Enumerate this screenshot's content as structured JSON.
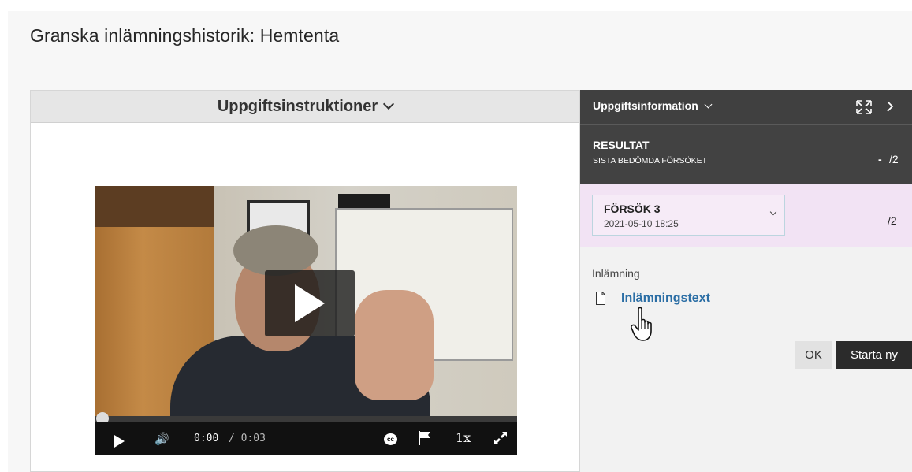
{
  "page": {
    "title": "Granska inlämningshistorik: Hemtenta"
  },
  "left_panel": {
    "header_label": "Uppgiftsinstruktioner"
  },
  "video": {
    "current_time": "0:00",
    "duration": "/ 0:03",
    "speed_label": "1x",
    "cc_label": "cc",
    "progress": 0
  },
  "right_panel": {
    "header_title": "Uppgiftsinformation",
    "result": {
      "title": "RESULTAT",
      "subtitle": "SISTA BEDÖMDA FÖRSÖKET",
      "score": "-",
      "max": "/2"
    },
    "attempt": {
      "title": "FÖRSÖK 3",
      "date": "2021-05-10 18:25",
      "max": "/2"
    },
    "submission": {
      "label": "Inlämning",
      "link_text": "Inlämningstext"
    },
    "buttons": {
      "ok": "OK",
      "start_new": "Starta ny"
    }
  },
  "icons": {
    "header_chevron": "chevron-down-icon",
    "expand": "expand-icon",
    "collapse": "chevron-right-icon",
    "file": "file-icon",
    "cursor": "hand-pointer-cursor-icon"
  }
}
